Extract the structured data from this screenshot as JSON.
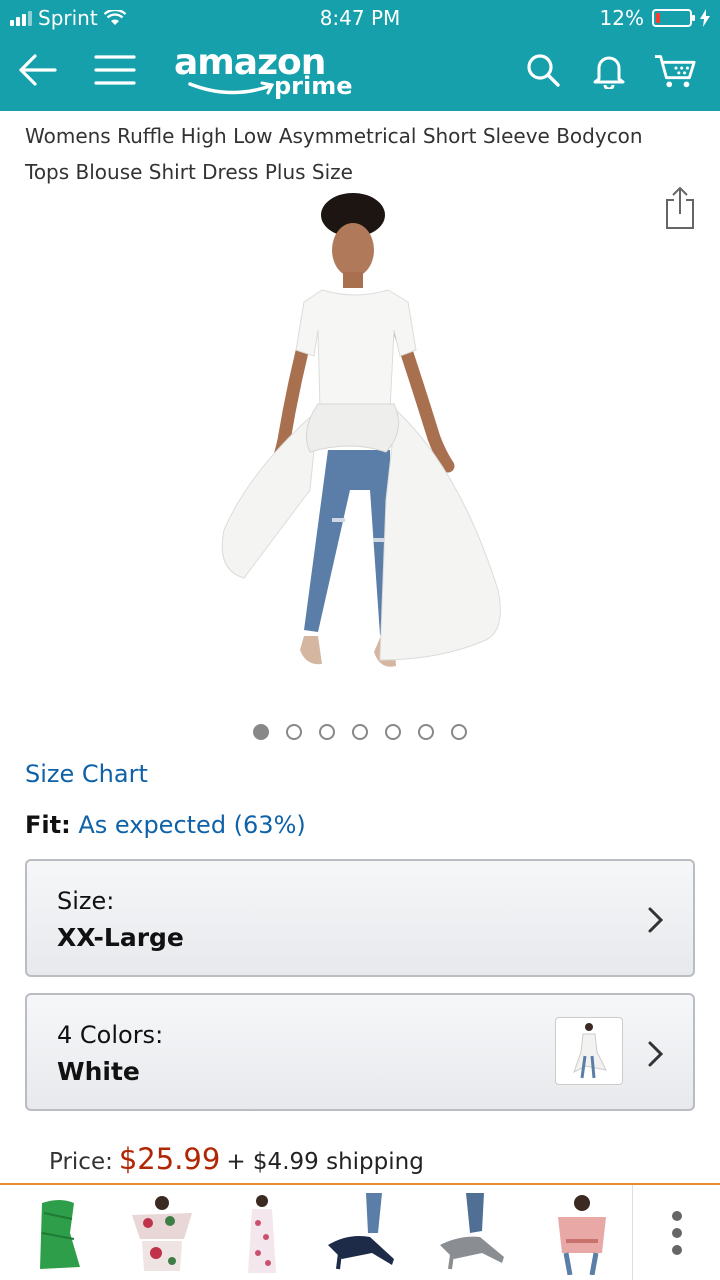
{
  "status_bar": {
    "carrier": "Sprint",
    "time": "8:47 PM",
    "battery": "12%",
    "battery_level": 0.12
  },
  "header": {
    "logo_text": "amazon",
    "logo_sub": "prime"
  },
  "product": {
    "title": "Womens Ruffle High Low Asymmetrical Short Sleeve Bodycon Tops Blouse Shirt Dress Plus Size",
    "image_count": 7,
    "active_image": 1
  },
  "size_chart_link": "Size Chart",
  "fit": {
    "label": "Fit:",
    "value": "As expected (63%)"
  },
  "size_selector": {
    "label": "Size:",
    "value": "XX-Large"
  },
  "color_selector": {
    "label": "4 Colors:",
    "value": "White"
  },
  "price": {
    "label": "Price:",
    "amount": "$25.99",
    "shipping": "+ $4.99 shipping"
  },
  "colors": {
    "header_bg": "#15a0ab",
    "link": "#0f62a8",
    "price": "#b12704",
    "strip_border": "#e98a2e"
  }
}
